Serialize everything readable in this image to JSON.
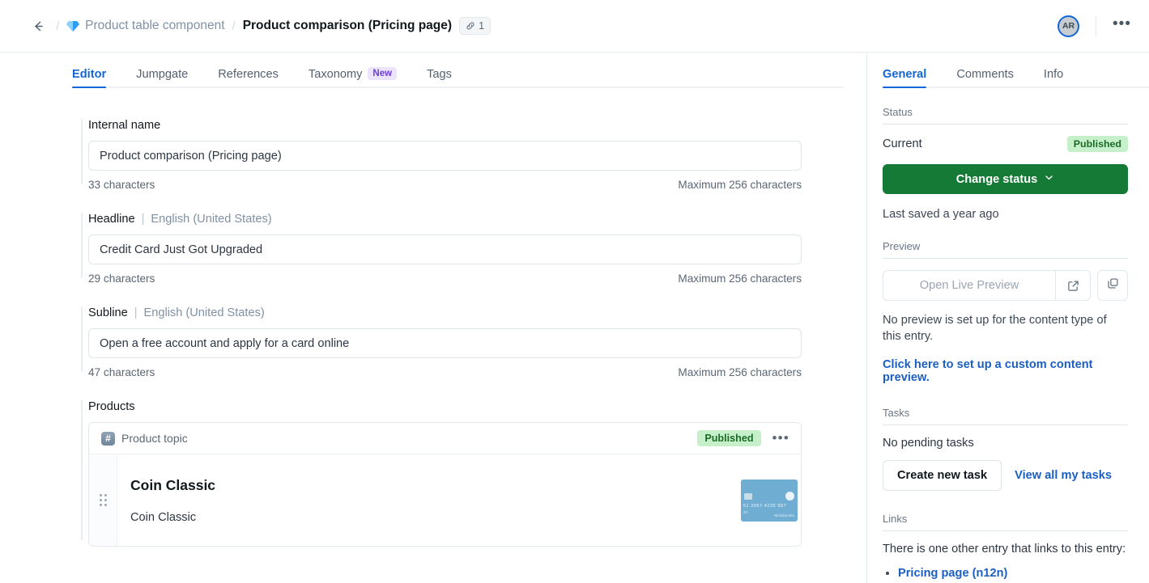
{
  "topbar": {
    "back_label": "←",
    "breadcrumb_parent": "Product table component",
    "breadcrumb_separator": "/",
    "breadcrumb_current": "Product comparison (Pricing page)",
    "link_count": "1",
    "avatar_initials": "AR",
    "more_label": "•••"
  },
  "main_tabs": [
    {
      "label": "Editor",
      "badge": ""
    },
    {
      "label": "Jumpgate",
      "badge": ""
    },
    {
      "label": "References",
      "badge": ""
    },
    {
      "label": "Taxonomy",
      "badge": "New"
    },
    {
      "label": "Tags",
      "badge": ""
    }
  ],
  "editor": {
    "internal_name": {
      "label": "Internal name",
      "value": "Product comparison (Pricing page)",
      "count": "33 characters",
      "max": "Maximum 256 characters"
    },
    "headline": {
      "label": "Headline",
      "divider": "|",
      "locale": "English (United States)",
      "value": "Credit Card Just Got Upgraded",
      "count": "29 characters",
      "max": "Maximum 256 characters"
    },
    "subline": {
      "label": "Subline",
      "divider": "|",
      "locale": "English (United States)",
      "value": "Open a free account and apply for a card online",
      "count": "47 characters",
      "max": "Maximum 256 characters"
    },
    "products": {
      "label": "Products",
      "entry": {
        "type_label": "Product topic",
        "status": "Published",
        "more_label": "•••",
        "title": "Coin Classic",
        "subtitle": "Coin Classic",
        "thumb_number": "51 3967 4235 987",
        "thumb_exp": "24",
        "thumb_name": "Nicholas Bro"
      }
    }
  },
  "sidebar": {
    "tabs": [
      {
        "label": "General"
      },
      {
        "label": "Comments"
      },
      {
        "label": "Info"
      }
    ],
    "status": {
      "section": "Status",
      "current_label": "Current",
      "current_value": "Published",
      "change_button": "Change status",
      "last_saved": "Last saved a year ago"
    },
    "preview": {
      "section": "Preview",
      "open_live_preview": "Open Live Preview",
      "note": "No preview is set up for the content type of this entry.",
      "link": "Click here to set up a custom content preview."
    },
    "tasks": {
      "section": "Tasks",
      "empty": "No pending tasks",
      "create_button": "Create new task",
      "view_all_link": "View all my tasks"
    },
    "links": {
      "section": "Links",
      "description": "There is one other entry that links to this entry:",
      "items": [
        "Pricing page (n12n)"
      ]
    }
  },
  "colors": {
    "accent_blue": "#1366d6",
    "green_button": "#147a35",
    "status_green_bg": "#c6f0c9",
    "status_green_text": "#1b6b28",
    "badge_purple_bg": "#ece4fb",
    "badge_purple_text": "#6b3fd4"
  }
}
